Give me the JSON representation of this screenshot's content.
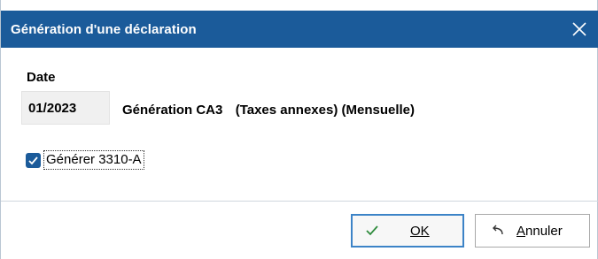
{
  "dialog": {
    "title": "Génération d'une déclaration",
    "close_icon": "close-icon"
  },
  "form": {
    "date_label": "Date",
    "date_value": "01/2023",
    "generation_title": "Génération CA3",
    "generation_detail": "(Taxes annexes)",
    "generation_period": "(Mensuelle)",
    "checkbox_label": "Générer 3310-A",
    "checkbox_checked": true
  },
  "buttons": {
    "ok_label": "OK",
    "ok_icon": "check-icon",
    "cancel_label_first": "A",
    "cancel_label_rest": "nnuler",
    "cancel_icon": "undo-arrow-icon"
  },
  "colors": {
    "titlebar": "#1b5b9a",
    "checkbox": "#1b5b9a",
    "ok_border": "#3c83c7",
    "ok_check": "#2e8b3c"
  }
}
